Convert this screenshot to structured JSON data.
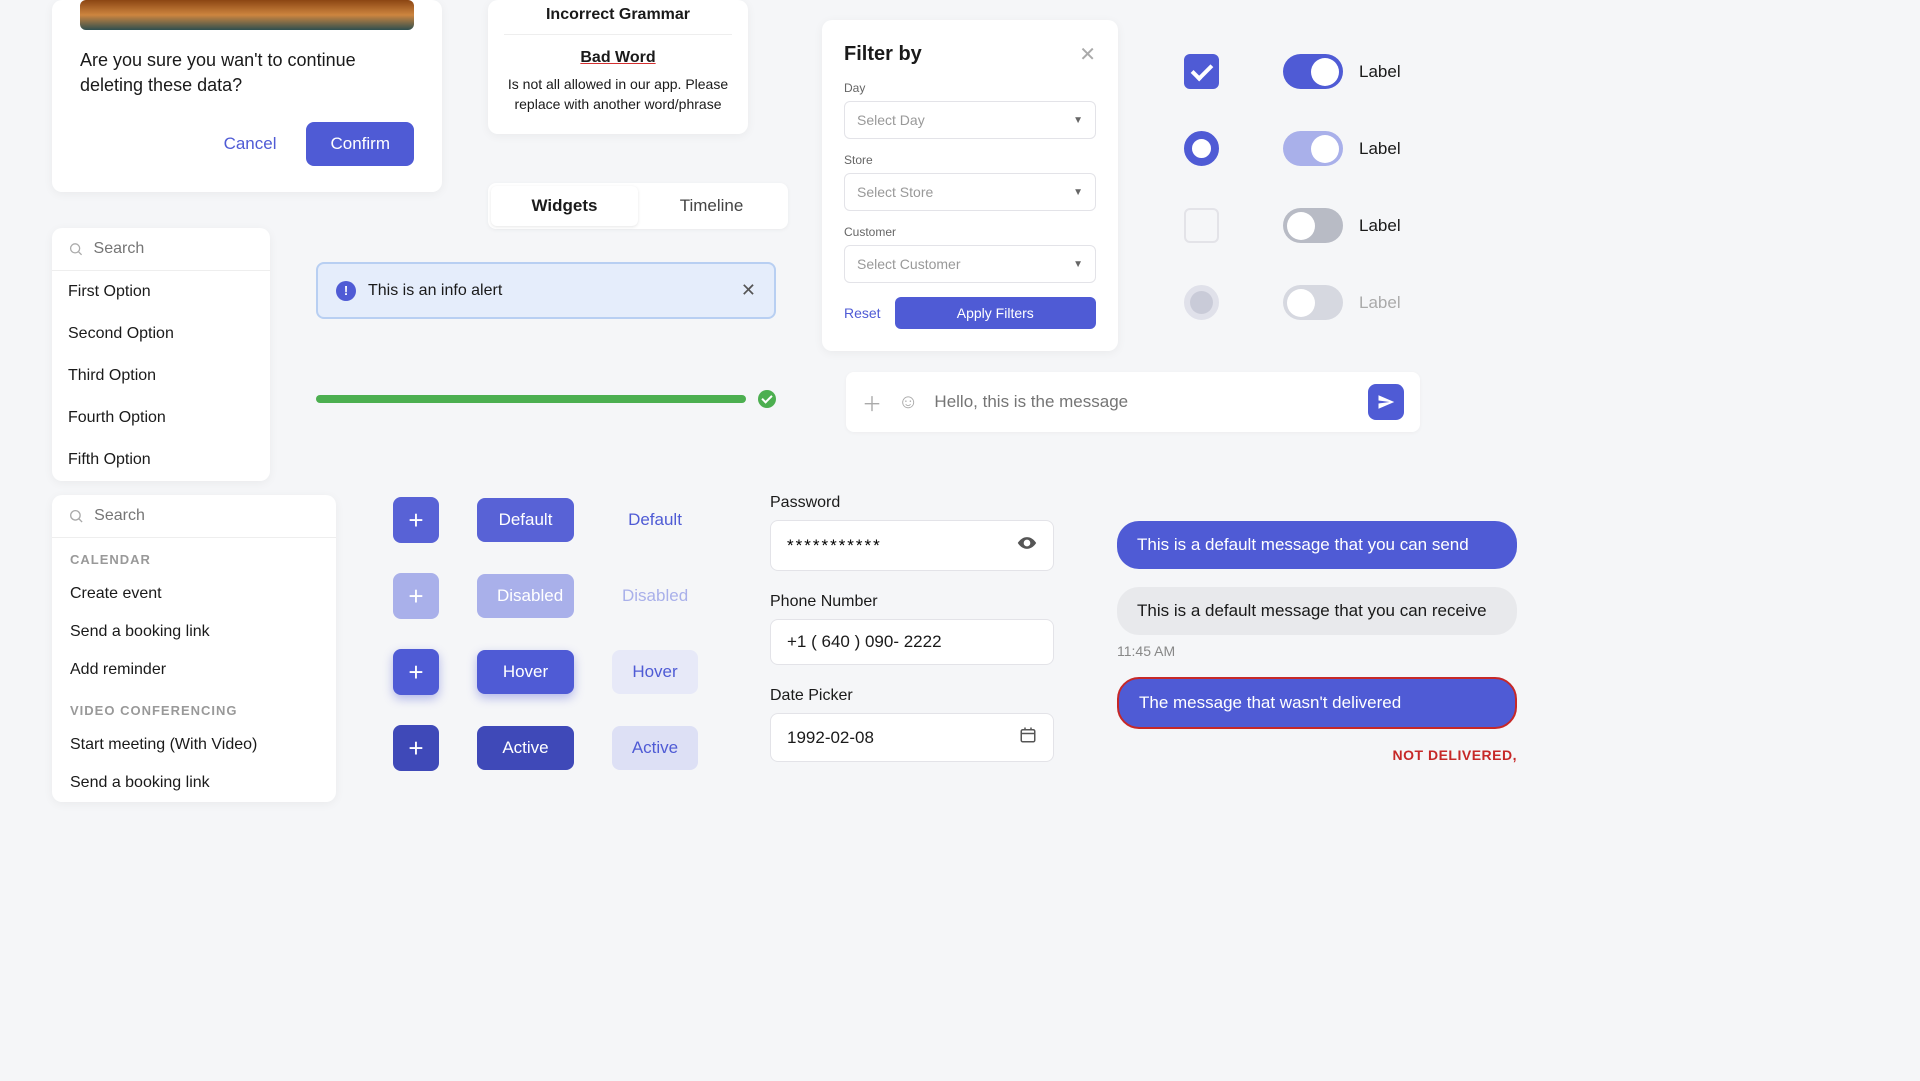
{
  "confirm_dialog": {
    "message": "Are you sure you wan't to continue deleting these data?",
    "cancel": "Cancel",
    "confirm": "Confirm"
  },
  "grammar": {
    "title": "Incorrect Grammar",
    "bad_word": "Bad Word",
    "desc": "Is not all allowed in our app. Please replace with another word/phrase"
  },
  "tabs": {
    "widgets": "Widgets",
    "timeline": "Timeline"
  },
  "filter": {
    "title": "Filter by",
    "day_label": "Day",
    "day_ph": "Select Day",
    "store_label": "Store",
    "store_ph": "Select Store",
    "customer_label": "Customer",
    "customer_ph": "Select Customer",
    "reset": "Reset",
    "apply": "Apply Filters"
  },
  "toggles": {
    "label": "Label"
  },
  "search": {
    "placeholder": "Search",
    "options": [
      "First Option",
      "Second Option",
      "Third Option",
      "Fourth Option",
      "Fifth Option"
    ]
  },
  "alert": {
    "text": "This is an info alert"
  },
  "message_input": {
    "placeholder": "Hello, this is the message"
  },
  "cat_search": {
    "placeholder": "Search",
    "calendar_title": "CALENDAR",
    "calendar_items": [
      "Create event",
      "Send a booking link",
      "Add reminder"
    ],
    "video_title": "VIDEO CONFERENCING",
    "video_items": [
      "Start meeting (With Video)",
      "Send a booking link"
    ]
  },
  "buttons": {
    "default": "Default",
    "disabled": "Disabled",
    "hover": "Hover",
    "active": "Active"
  },
  "form": {
    "password_label": "Password",
    "password_value": "***********",
    "phone_label": "Phone Number",
    "phone_value": "+1 ( 640 ) 090- 2222",
    "date_label": "Date Picker",
    "date_value": "1992-02-08"
  },
  "chat": {
    "sent": "This is a default message that you can send",
    "recv": "This is a default message that you can receive",
    "time": "11:45 AM",
    "error": "The message that wasn't delivered",
    "error_status": "NOT DELIVERED,"
  }
}
